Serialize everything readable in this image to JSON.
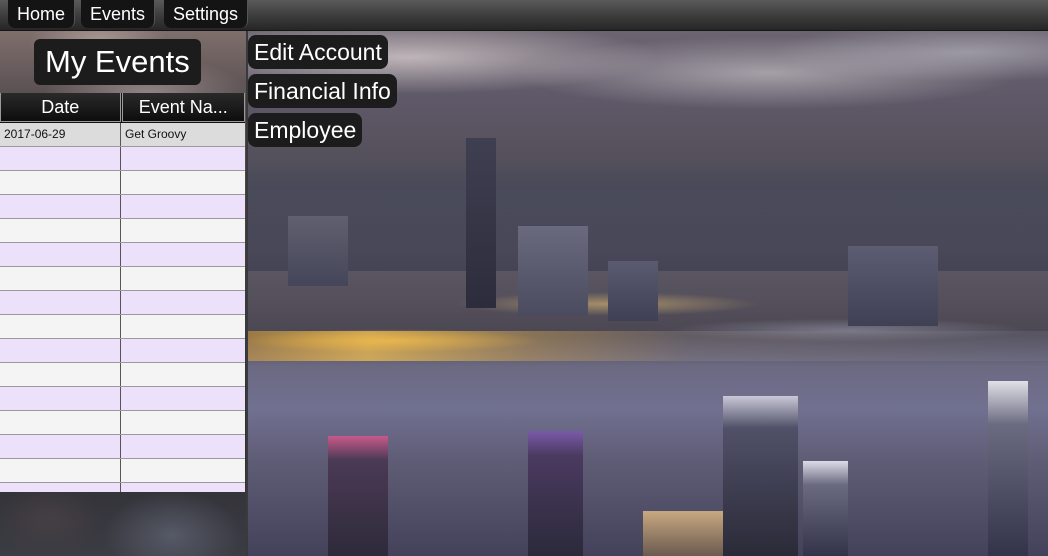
{
  "menu": {
    "home": "Home",
    "events": "Events",
    "settings": "Settings"
  },
  "left_panel": {
    "title": "My Events",
    "table": {
      "columns": [
        "Date",
        "Event Na..."
      ],
      "rows": [
        [
          "2017-06-29",
          "Get Groovy"
        ],
        [
          "",
          ""
        ],
        [
          "",
          ""
        ],
        [
          "",
          ""
        ],
        [
          "",
          ""
        ],
        [
          "",
          ""
        ],
        [
          "",
          ""
        ],
        [
          "",
          ""
        ],
        [
          "",
          ""
        ],
        [
          "",
          ""
        ],
        [
          "",
          ""
        ],
        [
          "",
          ""
        ],
        [
          "",
          ""
        ],
        [
          "",
          ""
        ],
        [
          "",
          ""
        ],
        [
          "",
          ""
        ]
      ]
    }
  },
  "main": {
    "buttons": {
      "edit_account": "Edit Account",
      "financial_info": "Financial Info",
      "employee": "Employee"
    },
    "background": "blurred-city-skyline-night"
  },
  "colors": {
    "row_odd": "#f4f4f4",
    "row_even": "#ece0fb",
    "row_selected": "#dcdcdc",
    "button_bg": "#1c1c1c",
    "text_light": "#ffffff"
  }
}
